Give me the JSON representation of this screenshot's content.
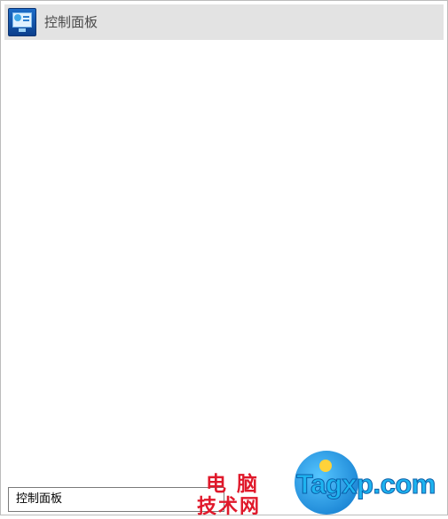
{
  "results": {
    "items": [
      {
        "title": "控制面板",
        "icon": "control-panel-icon"
      }
    ]
  },
  "search": {
    "query": "控制面板"
  },
  "watermark": {
    "cn_line1": "电脑",
    "cn_line2": "技术网",
    "brand": "Tagxp.com"
  },
  "colors": {
    "highlight": "#e3e3e3",
    "window_border": "#bcbcbc",
    "watermark_red": "#e0192b",
    "watermark_blue": "#1eb4f0"
  }
}
